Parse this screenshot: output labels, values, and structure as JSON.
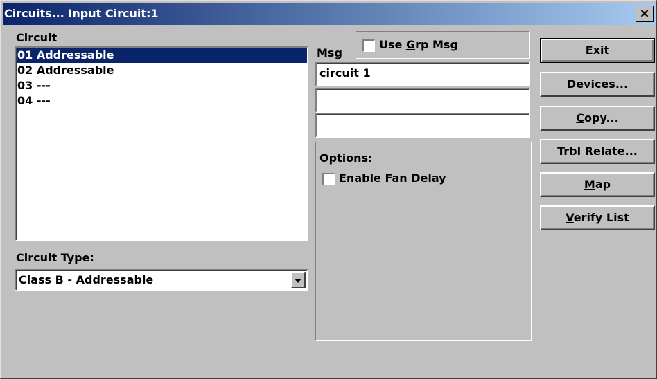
{
  "window": {
    "title": "Circuits... Input Circuit:1",
    "close_glyph": "×"
  },
  "circuit_list": {
    "label": "Circuit",
    "items": [
      "01 Addressable",
      "02 Addressable",
      "03 ---",
      "04 ---"
    ],
    "selected_index": 0
  },
  "circuit_type": {
    "label": "Circuit Type:",
    "value": "Class B - Addressable"
  },
  "msg": {
    "label": "Msg",
    "use_grp_msg": {
      "pre": "Use ",
      "accel": "G",
      "post": "rp Msg",
      "checked": false
    },
    "lines": [
      "circuit 1",
      "",
      ""
    ]
  },
  "options": {
    "label": "Options:",
    "enable_fan_delay": {
      "pre": "Enable Fan Del",
      "accel": "a",
      "post": "y",
      "checked": false
    }
  },
  "buttons": {
    "exit": {
      "pre": "",
      "accel": "E",
      "post": "xit"
    },
    "devices": {
      "pre": "",
      "accel": "D",
      "post": "evices..."
    },
    "copy": {
      "pre": "",
      "accel": "C",
      "post": "opy..."
    },
    "trbl_relate": {
      "pre": "Trbl ",
      "accel": "R",
      "post": "elate..."
    },
    "map": {
      "pre": "",
      "accel": "M",
      "post": "ap"
    },
    "verify_list": {
      "pre": "",
      "accel": "V",
      "post": "erify List"
    }
  }
}
